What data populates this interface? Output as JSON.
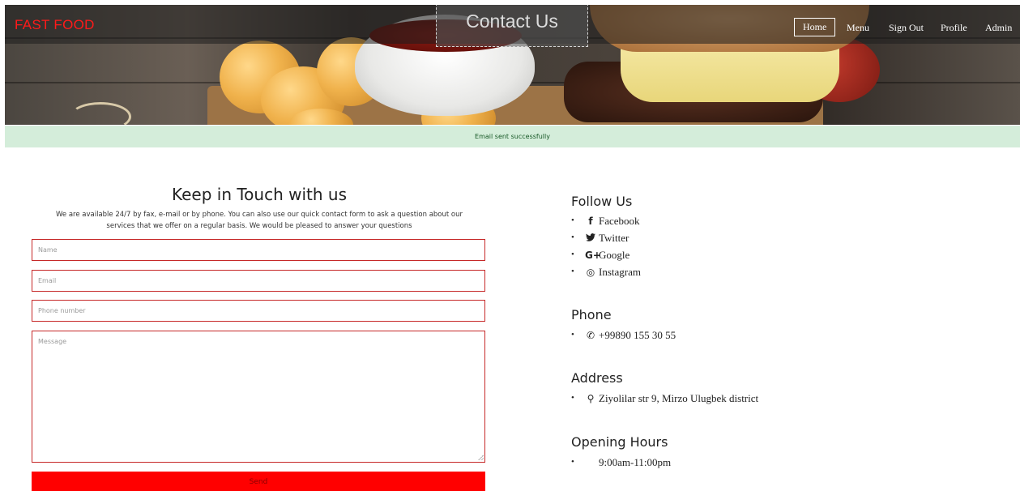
{
  "header": {
    "brand": "FAST FOOD",
    "page_title": "Contact Us",
    "nav": {
      "home": "Home",
      "menu": "Menu",
      "sign_out": "Sign Out",
      "profile": "Profile",
      "admin": "Admin"
    }
  },
  "alert": {
    "message": "Email sent successfully"
  },
  "form": {
    "title": "Keep in Touch with us",
    "description_line1": "We are available 24/7 by fax, e-mail or by phone. You can also use our quick contact form to ask a question about our",
    "description_line2": "services that we offer on a regular basis. We would be pleased to answer your questions",
    "name_placeholder": "Name",
    "email_placeholder": "Email",
    "phone_placeholder": "Phone number",
    "message_placeholder": "Message",
    "send_label": "Send"
  },
  "follow": {
    "title": "Follow Us",
    "items": [
      {
        "icon": "facebook-icon",
        "glyph": "f",
        "label": "Facebook"
      },
      {
        "icon": "twitter-icon",
        "glyph": "🐦",
        "label": "Twitter"
      },
      {
        "icon": "google-plus-icon",
        "glyph": "G+",
        "label": "Google"
      },
      {
        "icon": "instagram-icon",
        "glyph": "◎",
        "label": "Instagram"
      }
    ]
  },
  "phone": {
    "title": "Phone",
    "glyph": "✆",
    "value": "+99890 155 30 55"
  },
  "address": {
    "title": "Address",
    "glyph": "⚲",
    "value": "Ziyolilar str 9, Mirzo Ulugbek district"
  },
  "hours": {
    "title": "Opening Hours",
    "value": "9:00am-11:00pm"
  },
  "colors": {
    "brand_red": "#ff0000",
    "alert_bg": "#d4edda",
    "field_border": "#c62828"
  }
}
